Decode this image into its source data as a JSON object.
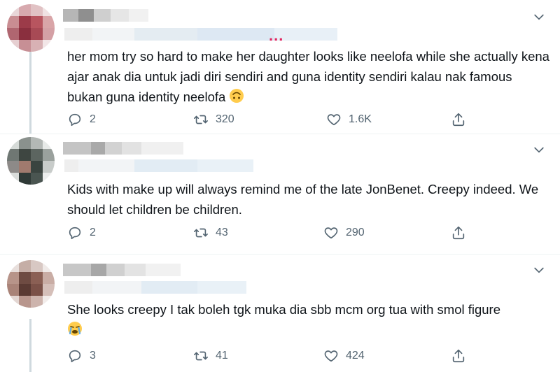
{
  "tweets": [
    {
      "text": "her mom try so hard to make her daughter looks like neelofa while she actually kena ajar anak dia untuk jadi diri sendiri and guna identity sendiri kalau nak famous bukan guna identity neelofa",
      "emoji": "upside-down-face-emoji",
      "replies": "2",
      "retweets": "320",
      "likes": "1.6K"
    },
    {
      "text": "Kids with make up will always remind me of the late JonBenet. Creepy indeed. We should let children be children.",
      "replies": "2",
      "retweets": "43",
      "likes": "290"
    },
    {
      "text": "She looks creepy I tak boleh tgk muka dia sbb mcm org tua with smol figure",
      "emoji": "crying-face-emoji",
      "replies": "3",
      "retweets": "41",
      "likes": "424"
    }
  ],
  "ellipsis": "...",
  "icons": {
    "reply": "reply-icon",
    "retweet": "retweet-icon",
    "like": "heart-icon",
    "share": "share-icon",
    "more": "chevron-down-icon"
  },
  "colors": {
    "text": "#0f1419",
    "secondary": "#536471",
    "ellipsis": "#e0245e",
    "thread_line": "#cfd9de"
  }
}
